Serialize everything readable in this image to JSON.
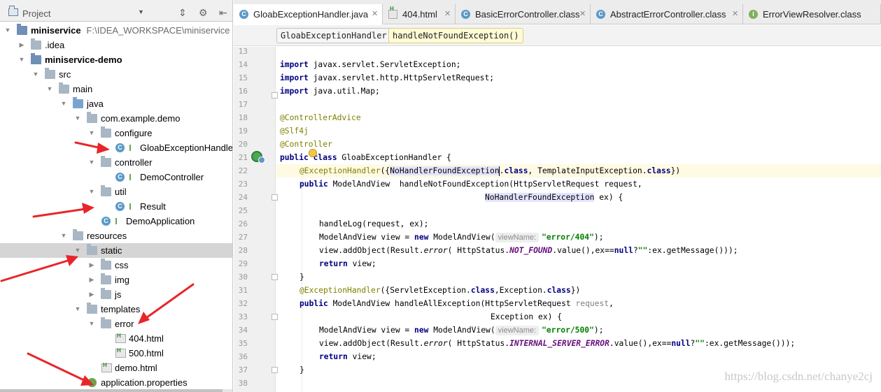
{
  "project_panel": {
    "title": "Project",
    "tree": [
      {
        "label": "miniservice",
        "suffix": "F:\\IDEA_WORKSPACE\\miniservice",
        "bold": true
      },
      {
        "label": ".idea"
      },
      {
        "label": "miniservice-demo",
        "bold": true
      },
      {
        "label": "src"
      },
      {
        "label": "main"
      },
      {
        "label": "java"
      },
      {
        "label": "com.example.demo"
      },
      {
        "label": "configure"
      },
      {
        "label": "GloabExceptionHandle"
      },
      {
        "label": "controller"
      },
      {
        "label": "DemoController"
      },
      {
        "label": "util"
      },
      {
        "label": "Result"
      },
      {
        "label": "DemoApplication"
      },
      {
        "label": "resources"
      },
      {
        "label": "static"
      },
      {
        "label": "css"
      },
      {
        "label": "img"
      },
      {
        "label": "js"
      },
      {
        "label": "templates"
      },
      {
        "label": "error"
      },
      {
        "label": "404.html"
      },
      {
        "label": "500.html"
      },
      {
        "label": "demo.html"
      },
      {
        "label": "application.properties"
      }
    ]
  },
  "editor": {
    "tabs": [
      {
        "label": "GloabExceptionHandler.java",
        "icon": "class-icon",
        "active": true
      },
      {
        "label": "404.html",
        "icon": "html-icon"
      },
      {
        "label": "BasicErrorController.class",
        "icon": "class-icon"
      },
      {
        "label": "AbstractErrorController.class",
        "icon": "class-icon"
      },
      {
        "label": "ErrorViewResolver.class",
        "icon": "interface-icon"
      }
    ],
    "breadcrumbs": [
      "GloabExceptionHandler",
      "handleNotFoundException()"
    ],
    "line_numbers": [
      "13",
      "14",
      "15",
      "16",
      "17",
      "18",
      "19",
      "20",
      "21",
      "22",
      "23",
      "24",
      "25",
      "26",
      "27",
      "28",
      "29",
      "30",
      "31",
      "32",
      "33",
      "34",
      "35",
      "36",
      "37",
      "38"
    ],
    "code": {
      "l14": [
        "import",
        " javax.servlet.ServletException;"
      ],
      "l15": [
        "import",
        " javax.servlet.http.HttpServletRequest;"
      ],
      "l16": [
        "import",
        " java.util.Map;"
      ],
      "l18": "@ControllerAdvice",
      "l19": "@Slf4j",
      "l20": "@Controller",
      "l21": [
        "public class",
        " GloabExceptionHandler {"
      ],
      "l22": [
        "@ExceptionHandler",
        "({",
        "NoHandlerFoundException",
        ".",
        "class",
        ", TemplateInputException.",
        "class",
        "})"
      ],
      "l23": [
        "public",
        " ModelAndView  handleNotFoundException(HttpServletRequest request,"
      ],
      "l24": [
        "NoHandlerFoundException",
        " ex) {"
      ],
      "l26": "handleLog(request, ex);",
      "l27": [
        "ModelAndView view = ",
        "new",
        " ModelAndView(",
        "viewName:",
        "\"error/404\"",
        ");"
      ],
      "l28": [
        "view.addObject(Result.",
        "error",
        "( HttpStatus.",
        "NOT_FOUND",
        ".value(),ex==",
        "null",
        "?",
        "\"\"",
        ":ex.getMessage()));"
      ],
      "l29": [
        "return",
        " view;"
      ],
      "l30": "}",
      "l31": [
        "@ExceptionHandler",
        "({ServletException.",
        "class",
        ",Exception.",
        "class",
        "})"
      ],
      "l32": [
        "public",
        " ModelAndView handleAllException(HttpServletRequest ",
        "request",
        ","
      ],
      "l33": "Exception ex) {",
      "l34": [
        "ModelAndView view = ",
        "new",
        " ModelAndView(",
        "viewName:",
        "\"error/500\"",
        ");"
      ],
      "l35": [
        "view.addObject(Result.",
        "error",
        "( HttpStatus.",
        "INTERNAL_SERVER_ERROR",
        ".value(),ex==",
        "null",
        "?",
        "\"\"",
        ":ex.getMessage()));"
      ],
      "l36": [
        "return",
        " view;"
      ],
      "l37": "}"
    },
    "watermark": "https://blog.csdn.net/chanye2cj"
  },
  "colors": {
    "arrow": "#e8262a",
    "keyword": "#000080",
    "annotation": "#808000",
    "string": "#008000",
    "constant": "#660e7a"
  }
}
